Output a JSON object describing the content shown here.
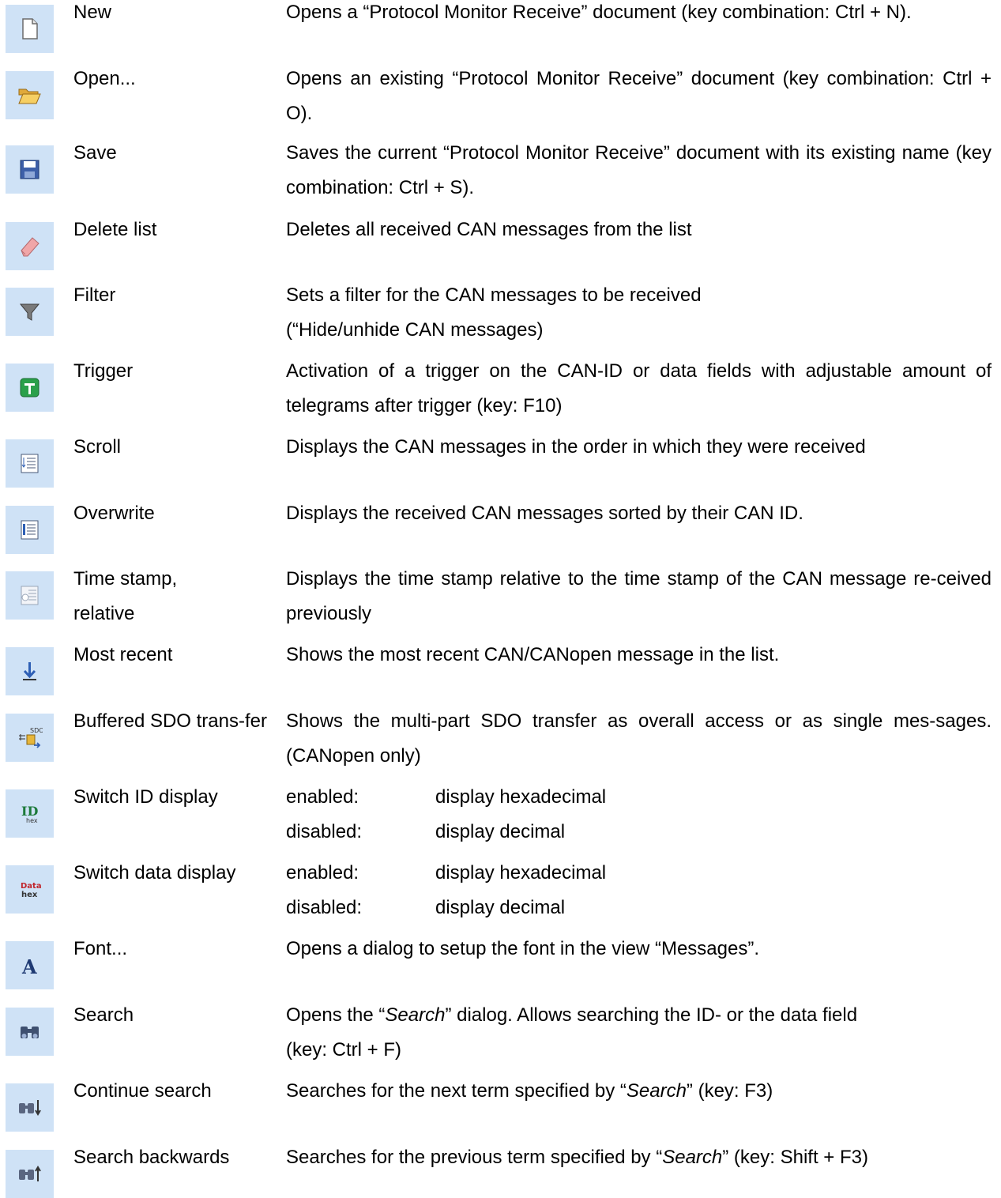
{
  "rows": [
    {
      "icon": "new-document-icon",
      "name": "New",
      "desc": "Opens a “Protocol Monitor Receive” document (key combination: Ctrl + N)."
    },
    {
      "icon": "open-folder-icon",
      "name": "Open...",
      "desc": "Opens an existing “Protocol Monitor Receive” document (key combination: Ctrl + O)."
    },
    {
      "icon": "save-disk-icon",
      "name": "Save",
      "desc": "Saves the current “Protocol Monitor Receive” document with its existing name (key combination: Ctrl + S)."
    },
    {
      "icon": "eraser-icon",
      "name": "Delete list",
      "desc": "Deletes all received CAN messages from the list"
    },
    {
      "icon": "filter-funnel-icon",
      "name": "Filter",
      "desc_line1": "Sets a filter for the CAN messages to be received",
      "desc_line2": "(“Hide/unhide CAN messages)"
    },
    {
      "icon": "trigger-icon",
      "name": "Trigger",
      "desc": "Activation of a trigger on the CAN-ID or data fields with adjustable amount of telegrams after trigger (key: F10)"
    },
    {
      "icon": "scroll-list-icon",
      "name": "Scroll",
      "desc": "Displays the CAN messages in the order in which they were received"
    },
    {
      "icon": "overwrite-list-icon",
      "name": "Overwrite",
      "desc": "Displays the received CAN messages sorted by their CAN ID."
    },
    {
      "icon": "time-stamp-icon",
      "name_line1": "Time stamp,",
      "name_line2": "relative",
      "desc": "Displays the time stamp relative to the time stamp of the CAN message re-ceived previously"
    },
    {
      "icon": "arrow-down-icon",
      "name": "Most recent",
      "desc": "Shows the most recent CAN/CANopen message in the list."
    },
    {
      "icon": "sdo-transfer-icon",
      "name": "Buffered SDO trans-fer",
      "desc": "Shows the multi-part SDO transfer as overall access or as single mes-sages. (CANopen only)"
    },
    {
      "icon": "id-hex-icon",
      "name": "Switch ID display",
      "k1": "enabled:",
      "v1": "display hexadecimal",
      "k2": "disabled:",
      "v2": "display decimal"
    },
    {
      "icon": "data-hex-icon",
      "name": "Switch data display",
      "k1": "enabled:",
      "v1": "display hexadecimal",
      "k2": "disabled:",
      "v2": "display decimal"
    },
    {
      "icon": "font-icon",
      "name": "Font...",
      "desc": "Opens a dialog to setup the font in the view “Messages”."
    },
    {
      "icon": "binoculars-icon",
      "name": "Search",
      "desc_pre": "Opens the “",
      "desc_em": "Search",
      "desc_post": "” dialog. Allows searching the ID- or the data field",
      "desc_line2": "(key: Ctrl + F)"
    },
    {
      "icon": "binoculars-down-icon",
      "name": "Continue search",
      "desc_pre": "Searches for the next term specified by “",
      "desc_em": "Search",
      "desc_post": "” (key: F3)"
    },
    {
      "icon": "binoculars-up-icon",
      "name": "Search backwards",
      "desc_pre": "Searches for the previous term specified by “",
      "desc_em": "Search",
      "desc_post": "” (key: Shift + F3)"
    }
  ]
}
